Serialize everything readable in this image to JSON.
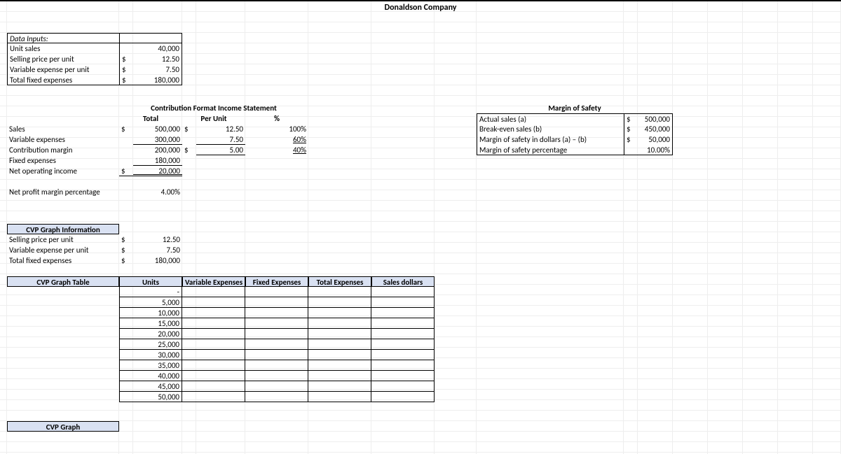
{
  "title": "Donaldson Company",
  "data_inputs": {
    "header": "Data Inputs:",
    "rows": [
      {
        "label": "Unit sales",
        "sym": "",
        "val": "40,000"
      },
      {
        "label": "Selling price per unit",
        "sym": "$",
        "val": "12.50"
      },
      {
        "label": "Variable expense per unit",
        "sym": "$",
        "val": "7.50"
      },
      {
        "label": "Total fixed expenses",
        "sym": "$",
        "val": "180,000"
      }
    ]
  },
  "cfis": {
    "title": "Contribution Format Income Statement",
    "col_total": "Total",
    "col_per_unit": "Per Unit",
    "col_pct": "%",
    "rows": {
      "sales": {
        "label": "Sales",
        "sym1": "$",
        "total": "500,000",
        "sym2": "$",
        "per": "12.50",
        "pct": "100%"
      },
      "var": {
        "label": "Variable expenses",
        "total": "300,000",
        "per": "7.50",
        "pct": "60%"
      },
      "cm": {
        "label": "Contribution margin",
        "total": "200,000",
        "sym2": "$",
        "per": "5.00",
        "pct": "40%"
      },
      "fixed": {
        "label": "Fixed expenses",
        "total": "180,000"
      },
      "noi": {
        "label": "Net operating income",
        "sym1": "$",
        "total": "20,000"
      }
    },
    "npm": {
      "label": "Net profit margin percentage",
      "val": "4.00%"
    }
  },
  "mos": {
    "title": "Margin of Safety",
    "rows": [
      {
        "label": "Actual sales (a)",
        "sym": "$",
        "val": "500,000"
      },
      {
        "label": "Break-even sales (b)",
        "sym": "$",
        "val": "450,000"
      },
      {
        "label": "Margin of safety in dollars (a) – (b)",
        "sym": "$",
        "val": "50,000"
      },
      {
        "label": "Margin of safety percentage",
        "sym": "",
        "val": "10.00%"
      }
    ]
  },
  "cvp_info": {
    "header": "CVP Graph Information",
    "rows": [
      {
        "label": "Selling price per unit",
        "sym": "$",
        "val": "12.50"
      },
      {
        "label": "Variable expense per unit",
        "sym": "$",
        "val": "7.50"
      },
      {
        "label": "Total fixed expenses",
        "sym": "$",
        "val": "180,000"
      }
    ]
  },
  "cvp_table": {
    "title": "CVP Graph Table",
    "headers": [
      "Units",
      "Variable Expenses",
      "Fixed Expenses",
      "Total Expenses",
      "Sales dollars"
    ],
    "units": [
      "-",
      "5,000",
      "10,000",
      "15,000",
      "20,000",
      "25,000",
      "30,000",
      "35,000",
      "40,000",
      "45,000",
      "50,000"
    ]
  },
  "cvp_graph": "CVP Graph"
}
